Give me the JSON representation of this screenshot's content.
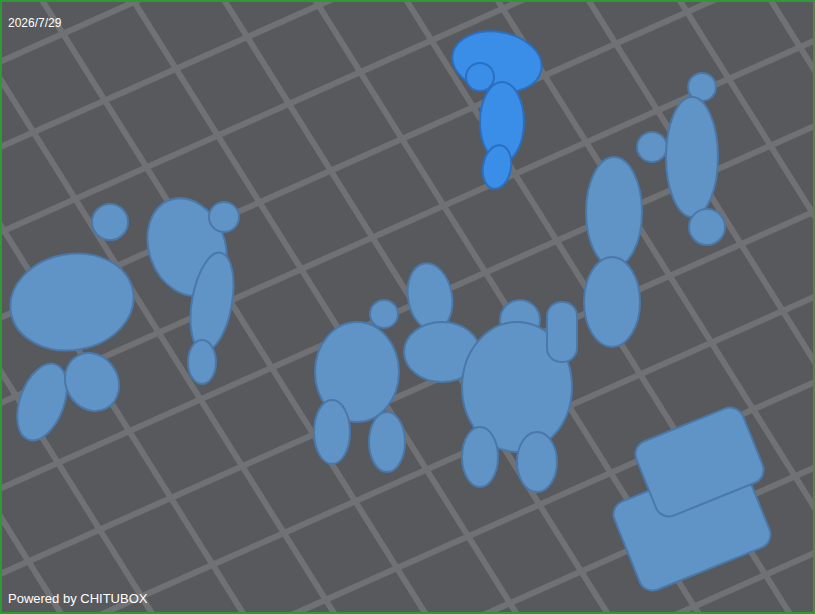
{
  "viewport": {
    "date": "2026/7/29",
    "watermark": "Powered by CHITUBOX"
  },
  "models": [
    {
      "kind": "figure",
      "selected": false
    },
    {
      "kind": "figure",
      "selected": false
    },
    {
      "kind": "figure",
      "selected": true
    },
    {
      "kind": "figure",
      "selected": false
    },
    {
      "kind": "figure",
      "selected": false
    },
    {
      "kind": "figure",
      "selected": false
    },
    {
      "kind": "sacks",
      "selected": false
    },
    {
      "kind": "figure",
      "selected": false
    },
    {
      "kind": "sacks",
      "selected": false
    }
  ]
}
